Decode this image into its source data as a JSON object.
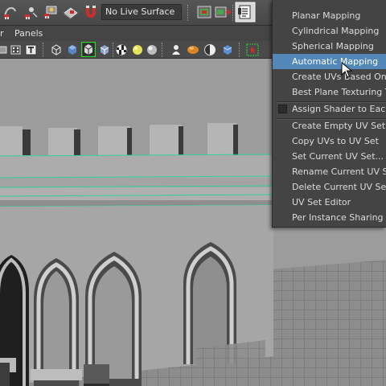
{
  "toolbar": {
    "live_surface_label": "No Live Surface",
    "icons": [
      "snap-curve-icon",
      "snap-point-icon",
      "snap-view-icon",
      "make-live-icon",
      "magnet-icon",
      "construction-history-icon",
      "render-icon",
      "ipr-render-icon",
      "render-settings-icon",
      "sidebar-toggle-icon"
    ]
  },
  "panel_menu": {
    "items": [
      "r",
      "Panels"
    ]
  },
  "panel_toolbar": {
    "icons": [
      "camera-attr-icon",
      "bookmark-icon",
      "image-plane-icon",
      "text-icon",
      "wireframe-icon",
      "smooth-shade-icon",
      "wireframe-on-shaded-icon",
      "xray-icon",
      "checker-icon",
      "default-light-icon",
      "shadows-icon",
      "sphere-icon",
      "torso-icon",
      "half-shade-icon",
      "cube-icon",
      "select-highlight-icon"
    ]
  },
  "menu": {
    "items": [
      {
        "label": "Planar Mapping",
        "highlighted": false
      },
      {
        "label": "Cylindrical Mapping",
        "highlighted": false
      },
      {
        "label": "Spherical Mapping",
        "highlighted": false
      },
      {
        "label": "Automatic Mapping",
        "highlighted": true
      },
      {
        "label": "Create UVs Based On Ca",
        "highlighted": false
      },
      {
        "label": "Best Plane Texturing Too",
        "highlighted": false
      },
      {
        "label": "Assign Shader to Each Pr",
        "highlighted": false,
        "checkbox": true
      },
      {
        "label": "Create Empty UV Set",
        "highlighted": false
      },
      {
        "label": "Copy UVs to UV Set",
        "highlighted": false
      },
      {
        "label": "Set Current UV Set...",
        "highlighted": false
      },
      {
        "label": "Rename Current UV Set...",
        "highlighted": false
      },
      {
        "label": "Delete Current UV Set",
        "highlighted": false
      },
      {
        "label": "UV Set Editor",
        "highlighted": false
      },
      {
        "label": "Per Instance Sharing",
        "highlighted": false
      }
    ]
  },
  "colors": {
    "highlight": "#5287b8",
    "menu_bg": "#444444",
    "viewport_bg": "#9c9c9c",
    "selection_outline": "#2fd39a"
  }
}
